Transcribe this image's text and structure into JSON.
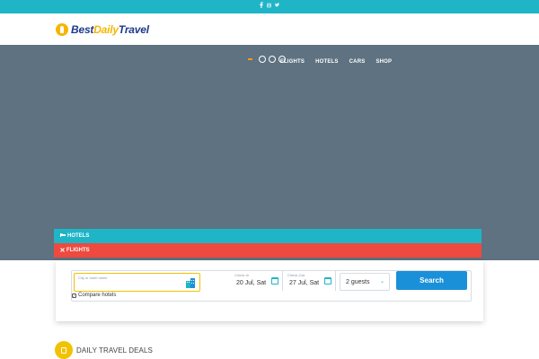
{
  "topbar": {
    "social_icons": [
      "facebook-icon",
      "instagram-icon",
      "twitter-icon"
    ],
    "color": "#1fb5c7"
  },
  "logo": {
    "part1": "Best",
    "part2": "Daily",
    "part3": "Travel"
  },
  "nav": {
    "items": [
      "FLIGHTS",
      "HOTELS",
      "CARS",
      "SHOP"
    ]
  },
  "tabs": {
    "hotels": "HOTELS",
    "flights": "FLIGHTS"
  },
  "search": {
    "city_label": "City or hotel name",
    "city_value": "",
    "checkin_label": "Check-In",
    "checkin_value": "20 Jul, Sat",
    "checkout_label": "Check-Out",
    "checkout_value": "27 Jul, Sat",
    "guests_value": "2 guests",
    "search_button": "Search",
    "compare_label": "Compare hotels",
    "compare_checked": true
  },
  "deals": {
    "title": "DAILY TRAVEL DEALS"
  },
  "colors": {
    "accent": "#1fb5c7",
    "flights_tab": "#ee4a3f",
    "button": "#1a90d9",
    "logo_yellow": "#f7b500",
    "hero_bg": "#5e7281"
  }
}
